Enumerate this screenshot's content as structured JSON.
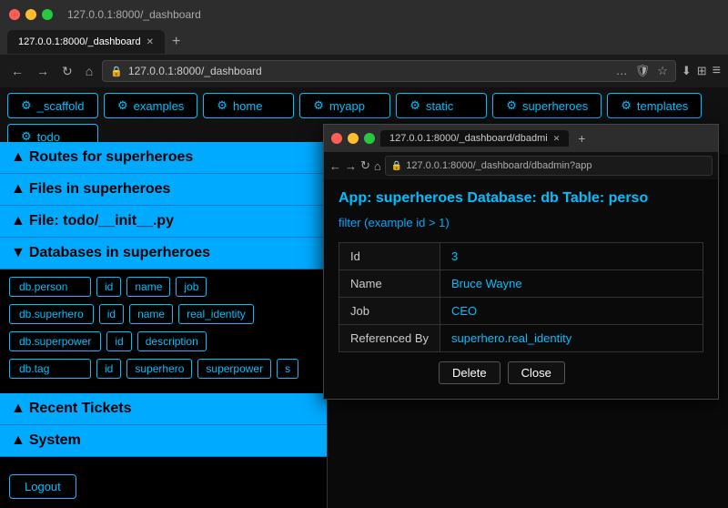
{
  "browser": {
    "titlebar": {
      "title": "127.0.0.1:8000/_dashboard"
    },
    "tab": {
      "label": "127.0.0.1:8000/_dashboard"
    },
    "address": "127.0.0.1:8000/_dashboard"
  },
  "nav_buttons": [
    {
      "id": "scaffold",
      "label": "_scaffold"
    },
    {
      "id": "examples",
      "label": "examples"
    },
    {
      "id": "home",
      "label": "home"
    },
    {
      "id": "myapp",
      "label": "myapp"
    },
    {
      "id": "static",
      "label": "static"
    },
    {
      "id": "superheroes",
      "label": "superheroes"
    },
    {
      "id": "templates",
      "label": "templates"
    },
    {
      "id": "todo",
      "label": "todo"
    }
  ],
  "sidebar": {
    "sections": [
      {
        "id": "routes",
        "label": "Routes for superheroes",
        "arrow": "▲",
        "open": true
      },
      {
        "id": "files",
        "label": "Files in superheroes",
        "arrow": "▲",
        "open": true
      },
      {
        "id": "file_todo",
        "label": "File: todo/__init__.py",
        "arrow": "▲",
        "open": true
      },
      {
        "id": "databases",
        "label": "Databases in superheroes",
        "arrow": "▼",
        "open": true
      }
    ],
    "databases": [
      {
        "name": "db.person",
        "fields": [
          "id",
          "name",
          "job"
        ]
      },
      {
        "name": "db.superhero",
        "fields": [
          "id",
          "name",
          "real_identity"
        ]
      },
      {
        "name": "db.superpower",
        "fields": [
          "id",
          "description"
        ]
      },
      {
        "name": "db.tag",
        "fields": [
          "id",
          "superhero",
          "superpower",
          "s"
        ]
      }
    ],
    "recent_tickets": {
      "label": "Recent Tickets",
      "arrow": "▲"
    },
    "system": {
      "label": "System",
      "arrow": "▲"
    },
    "logout": "Logout"
  },
  "popup": {
    "titlebar_text": "127.0.0.1:8000/_dashboard/dbadmi",
    "address": "127.0.0.1:8000/_dashboard/dbadmin?app",
    "title": "App: superheroes Database: db Table: perso",
    "filter": "filter (example id > 1)",
    "record": {
      "id_label": "Id",
      "id_value": "3",
      "name_label": "Name",
      "name_value": "Bruce Wayne",
      "job_label": "Job",
      "job_value": "CEO",
      "referenced_by_label": "Referenced By",
      "referenced_by_value": "superhero.real_identity"
    },
    "delete_label": "Delete",
    "close_label": "Close"
  }
}
